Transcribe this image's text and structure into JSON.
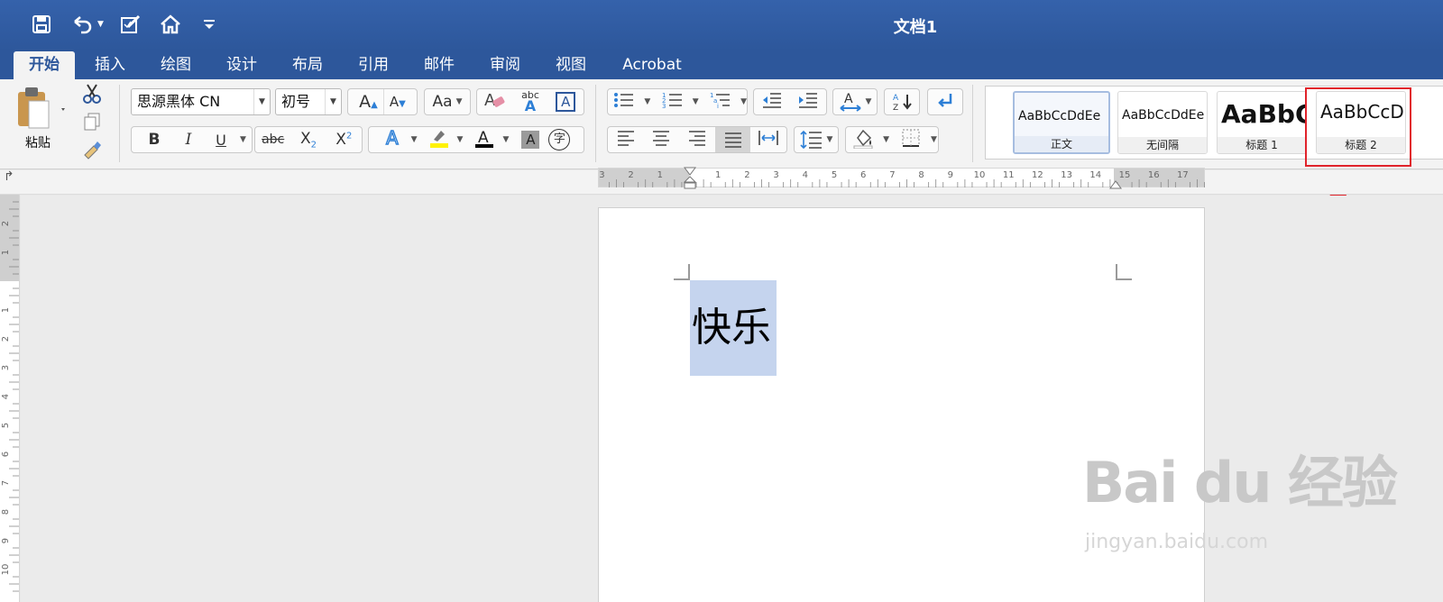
{
  "window": {
    "title": "文档1"
  },
  "tabs": [
    "开始",
    "插入",
    "绘图",
    "设计",
    "布局",
    "引用",
    "邮件",
    "审阅",
    "视图",
    "Acrobat"
  ],
  "active_tab": "开始",
  "clipboard": {
    "paste_label": "粘贴"
  },
  "font": {
    "name": "思源黑体 CN",
    "size": "初号"
  },
  "format_buttons": {
    "bold": "B",
    "italic": "I",
    "underline": "U",
    "strike": "abc",
    "subscript": "X",
    "superscript": "X",
    "sub_mark": "2",
    "sup_mark": "2"
  },
  "misc_labels": {
    "grow": "A",
    "shrink": "A",
    "case": "Aa",
    "abc": "abc",
    "text_box": "A",
    "char_border": "字",
    "sort": "A Z"
  },
  "styles": [
    {
      "sample": "AaBbCcDdEe",
      "label": "正文"
    },
    {
      "sample": "AaBbCcDdEe",
      "label": "无间隔"
    },
    {
      "sample": "AaBbC",
      "label": "标题 1"
    },
    {
      "sample": "AaBbCcD",
      "label": "标题 2"
    }
  ],
  "ruler": {
    "h_numbers": [
      "3",
      "2",
      "1",
      "1",
      "2",
      "3",
      "4",
      "5",
      "6",
      "7",
      "8",
      "9",
      "10",
      "11",
      "12",
      "13",
      "14",
      "15",
      "16",
      "17"
    ],
    "v_numbers": [
      "2",
      "1",
      "1",
      "2",
      "3",
      "4",
      "5",
      "6",
      "7",
      "8",
      "9",
      "10"
    ]
  },
  "document": {
    "text": "快乐"
  },
  "watermark": {
    "logo": "Bai du 经验",
    "url": "jingyan.baidu.com"
  },
  "colors": {
    "accent": "#2d579b",
    "highlight": "#e0232b",
    "selection": "#c5d4ee"
  }
}
